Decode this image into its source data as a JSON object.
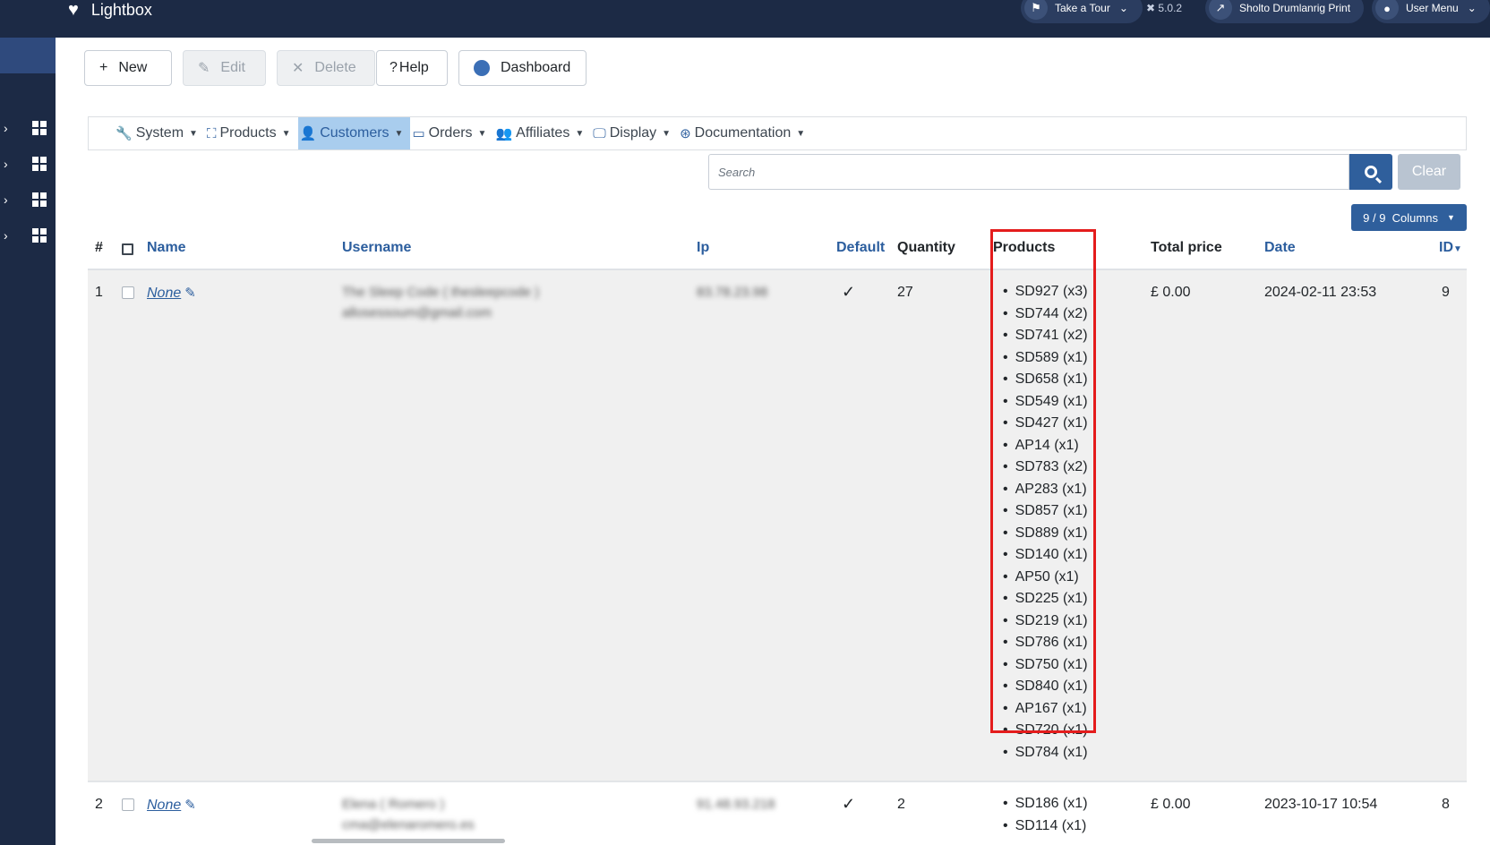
{
  "header": {
    "brand": "Lightbox",
    "tour_label": "Take a Tour",
    "version": "5.0.2",
    "site_label": "Sholto Drumlanrig Print",
    "user_menu_label": "User Menu"
  },
  "toolbar": {
    "new_label": "New",
    "edit_label": "Edit",
    "delete_label": "Delete",
    "help_label": "Help",
    "dashboard_label": "Dashboard"
  },
  "menu": {
    "items": [
      {
        "label": "System",
        "icon": "wrench-icon"
      },
      {
        "label": "Products",
        "icon": "cubes-icon"
      },
      {
        "label": "Customers",
        "icon": "user-icon",
        "active": true
      },
      {
        "label": "Orders",
        "icon": "credit-card-icon"
      },
      {
        "label": "Affiliates",
        "icon": "users-icon"
      },
      {
        "label": "Display",
        "icon": "desktop-icon"
      },
      {
        "label": "Documentation",
        "icon": "life-ring-icon"
      }
    ]
  },
  "search": {
    "placeholder": "Search",
    "clear_label": "Clear",
    "columns_label": "9 / 9  Columns"
  },
  "table": {
    "headers": {
      "num": "#",
      "name": "Name",
      "username": "Username",
      "ip": "Ip",
      "default": "Default",
      "quantity": "Quantity",
      "products": "Products",
      "total_price": "Total price",
      "date": "Date",
      "id": "ID"
    },
    "rows": [
      {
        "num": "1",
        "name": "None",
        "username_line1": "The Sleep Code ( thesleepcode )",
        "username_line2": "allosessoum@gmail.com",
        "ip": "83.78.23.98",
        "default": "✓",
        "quantity": "27",
        "products": [
          "SD927 (x3)",
          "SD744 (x2)",
          "SD741 (x2)",
          "SD589 (x1)",
          "SD658 (x1)",
          "SD549 (x1)",
          "SD427 (x1)",
          "AP14 (x1)",
          "SD783 (x2)",
          "AP283 (x1)",
          "SD857 (x1)",
          "SD889 (x1)",
          "SD140 (x1)",
          "AP50 (x1)",
          "SD225 (x1)",
          "SD219 (x1)",
          "SD786 (x1)",
          "SD750 (x1)",
          "SD840 (x1)",
          "AP167 (x1)",
          "SD720 (x1)",
          "SD784 (x1)"
        ],
        "total_price": "£ 0.00",
        "date": "2024-02-11 23:53",
        "id": "9"
      },
      {
        "num": "2",
        "name": "None",
        "username_line1": "Elena ( Romero )",
        "username_line2": "cma@elenaromero.es",
        "ip": "91.48.93.218",
        "default": "✓",
        "quantity": "2",
        "products": [
          "SD186 (x1)",
          "SD114 (x1)"
        ],
        "total_price": "£ 0.00",
        "date": "2023-10-17 10:54",
        "id": "8"
      }
    ]
  }
}
